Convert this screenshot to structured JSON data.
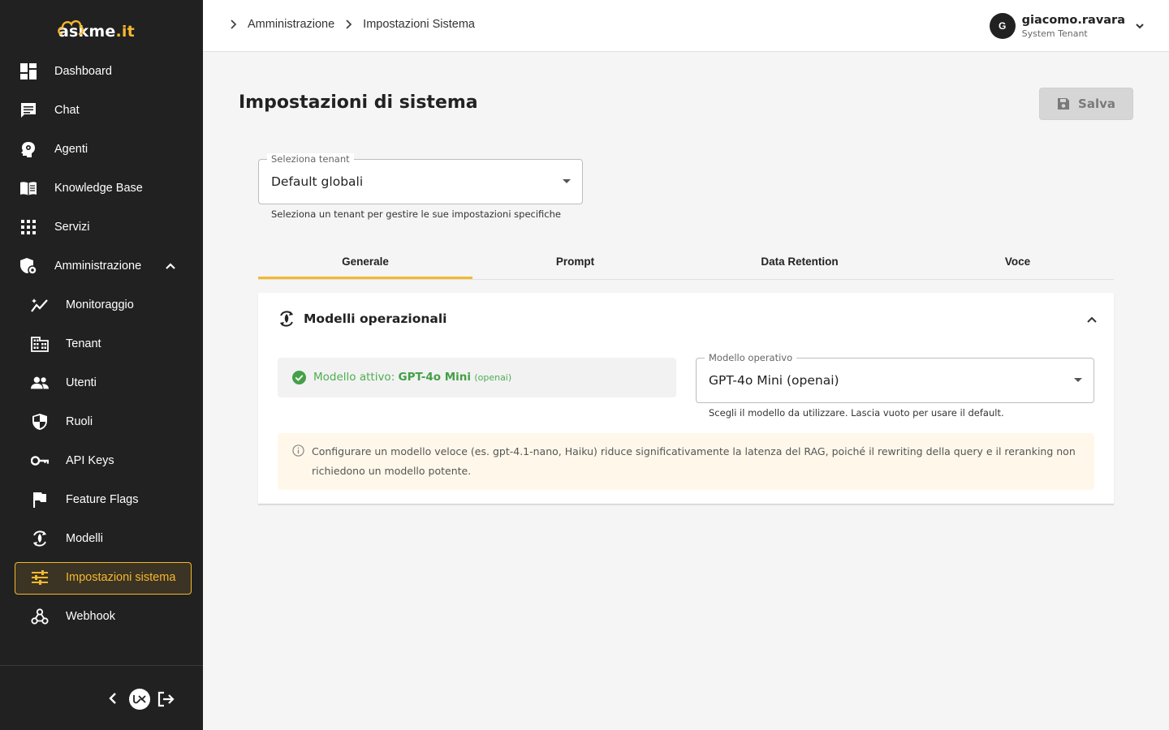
{
  "app": {
    "logo_text": "askme",
    "logo_suffix": ".it"
  },
  "sidebar": {
    "items": [
      {
        "label": "Dashboard"
      },
      {
        "label": "Chat"
      },
      {
        "label": "Agenti"
      },
      {
        "label": "Knowledge Base"
      },
      {
        "label": "Servizi"
      },
      {
        "label": "Amministrazione"
      },
      {
        "label": "Monitoraggio"
      },
      {
        "label": "Tenant"
      },
      {
        "label": "Utenti"
      },
      {
        "label": "Ruoli"
      },
      {
        "label": "API Keys"
      },
      {
        "label": "Feature Flags"
      },
      {
        "label": "Modelli"
      },
      {
        "label": "Impostazioni sistema"
      },
      {
        "label": "Webhook"
      }
    ],
    "active_index": 13
  },
  "breadcrumb": {
    "items": [
      "Amministrazione",
      "Impostazioni Sistema"
    ]
  },
  "user": {
    "initial": "G",
    "name": "giacomo.ravara",
    "tenant": "System Tenant"
  },
  "page": {
    "title": "Impostazioni di sistema",
    "save_label": "Salva"
  },
  "tenant_select": {
    "label": "Seleziona tenant",
    "value": "Default globali",
    "helper": "Seleziona un tenant per gestire le sue impostazioni specifiche"
  },
  "tabs": [
    {
      "label": "Generale",
      "active": true
    },
    {
      "label": "Prompt",
      "active": false
    },
    {
      "label": "Data Retention",
      "active": false
    },
    {
      "label": "Voce",
      "active": false
    }
  ],
  "section": {
    "title": "Modelli operazionali",
    "active_model_prefix": "Modello attivo:",
    "active_model_name": "GPT-4o Mini",
    "active_model_provider": "(openai)",
    "model_select": {
      "label": "Modello operativo",
      "value": "GPT-4o Mini (openai)",
      "helper": "Scegli il modello da utilizzare. Lascia vuoto per usare il default."
    },
    "info": "Configurare un modello veloce (es. gpt-4.1-nano, Haiku) riduce significativamente la latenza del RAG, poiché il rewriting della query e il reranking non richiedono un modello potente."
  },
  "colors": {
    "accent": "#f5b82e",
    "sidebar_bg": "#212121",
    "success": "#4caf50",
    "info_bg": "#fff8ea"
  }
}
